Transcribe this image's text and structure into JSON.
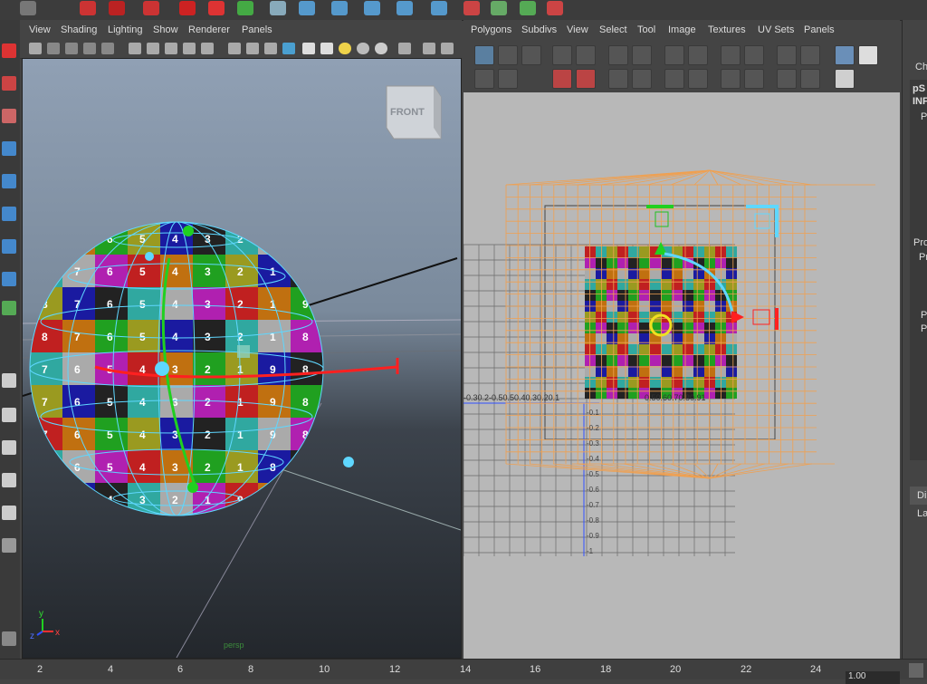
{
  "persp_panel": {
    "menu": [
      "View",
      "Shading",
      "Lighting",
      "Show",
      "Renderer",
      "Panels"
    ],
    "view_cube_label": "FRONT",
    "camera_label": "persp",
    "axis": {
      "x": "x",
      "y": "y",
      "z": "z"
    },
    "sphere_numbers": [
      "8",
      "7",
      "6",
      "5",
      "4",
      "3",
      "2",
      "1",
      "9",
      "8",
      "7",
      "6",
      "5",
      "4",
      "3",
      "2",
      "1",
      "9",
      "8",
      "7",
      "6",
      "5",
      "4",
      "3",
      "2",
      "1",
      "9",
      "8",
      "7",
      "6",
      "5",
      "4",
      "3",
      "2",
      "1"
    ]
  },
  "uv_panel": {
    "menu": [
      "Polygons",
      "Subdivs",
      "View",
      "Select",
      "Tool",
      "Image",
      "Textures",
      "UV Sets",
      "Panels"
    ],
    "axis_x_labels": "-0.30.2-0.50.50.40.30.20.1",
    "axis_x_labels_right": "0.50.60.70.80.91",
    "axis_y_labels": [
      "-0.1",
      "-0.2",
      "-0.3",
      "-0.4",
      "-0.5",
      "-0.6",
      "-0.7",
      "-0.8",
      "-0.9",
      "-1"
    ]
  },
  "right_panel": {
    "lines": [
      "Ch",
      "pS",
      "INF",
      "P",
      "Pro",
      "Pr",
      "P",
      "P",
      "Di",
      "La"
    ]
  },
  "timeline": {
    "ticks": [
      "2",
      "4",
      "6",
      "8",
      "10",
      "12",
      "14",
      "16",
      "18",
      "20",
      "22",
      "24"
    ],
    "current_frame": "1.00"
  },
  "colors": {
    "accent_cyan": "#5fd7ff",
    "wire_orange": "#f0a050",
    "manip_red": "#ff2020",
    "manip_green": "#20d020"
  }
}
